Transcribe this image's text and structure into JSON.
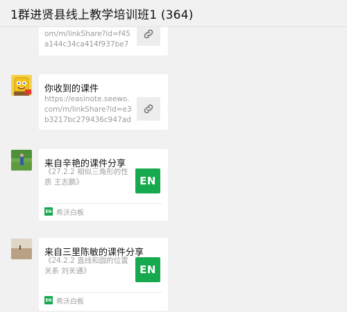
{
  "header": {
    "title": "1群进贤县线上教学培训班1 (364)"
  },
  "messages": [
    {
      "title": "",
      "link": "om/m/linkShare?id=f45a144c34ca414f937be76...",
      "icon": "link-icon"
    },
    {
      "title": "你收到的课件",
      "link": "https://easinote.seewo.com/m/linkShare?id=e3b3217bc279436c947add...",
      "icon": "link-icon"
    },
    {
      "title": "来自辛艳的课件分享",
      "desc": "《27.2.2 相似三角形的性质 王志鹏》",
      "badge": "EN",
      "source_badge": "EN",
      "source": "希沃白板"
    },
    {
      "title": "来自三里陈敏的课件分享",
      "desc": "《24.2.2 直线和圆的位置关系 刘关通》",
      "badge": "EN",
      "source_badge": "EN",
      "source": "希沃白板"
    }
  ],
  "colors": {
    "background": "#f1f1f1",
    "card": "#ffffff",
    "brand_green": "#16a94d"
  }
}
